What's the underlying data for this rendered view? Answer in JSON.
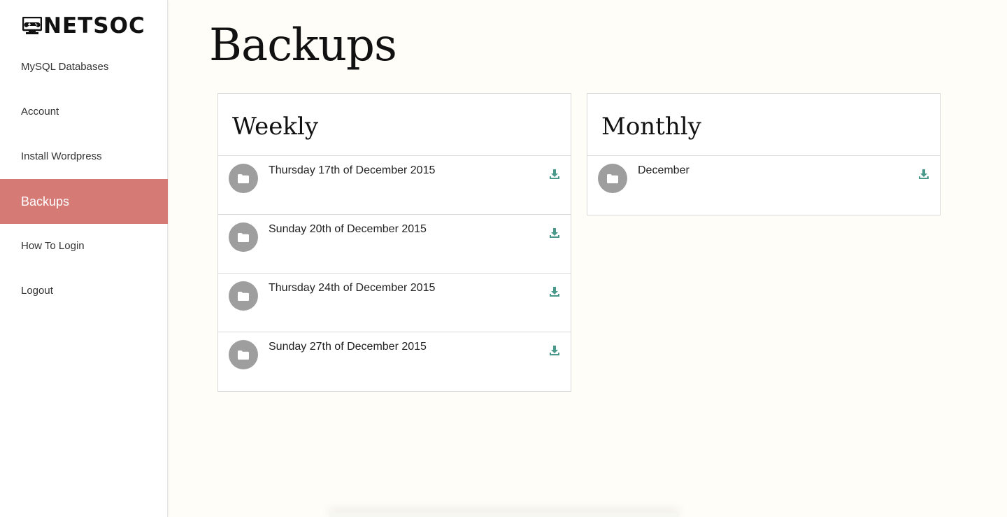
{
  "logo": {
    "text": "NETSOC",
    "icon": "computer-gamepad-icon"
  },
  "nav": {
    "items": [
      {
        "label": "MySQL Databases",
        "active": false
      },
      {
        "label": "Account",
        "active": false
      },
      {
        "label": "Install Wordpress",
        "active": false
      },
      {
        "label": "Backups",
        "active": true
      },
      {
        "label": "How To Login",
        "active": false
      },
      {
        "label": "Logout",
        "active": false
      }
    ]
  },
  "page": {
    "title": "Backups"
  },
  "weekly": {
    "title": "Weekly",
    "rows": [
      {
        "label": "Thursday 17th of December 2015"
      },
      {
        "label": "Sunday 20th of December 2015"
      },
      {
        "label": "Thursday 24th of December 2015"
      },
      {
        "label": "Sunday 27th of December 2015"
      }
    ]
  },
  "monthly": {
    "title": "Monthly",
    "rows": [
      {
        "label": "December"
      }
    ]
  },
  "colors": {
    "accent": "#d57a75",
    "download": "#4a9a8c",
    "folder_circle": "#9e9e9e",
    "background": "#fefdf8"
  }
}
